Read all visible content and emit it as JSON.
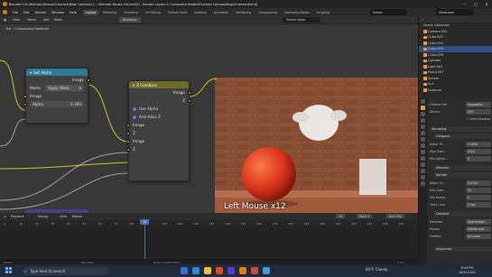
{
  "window": {
    "title": "Blender* [D:\\Blender\\Manual\\Courses\\New Courses\\11 - Ultimate Nodes Course\\00 - Render Layers & Composite Nodes\\Finished Compositing\\Finished.blend]",
    "minimize": "—",
    "maximize": "□",
    "close": "✕"
  },
  "menu": {
    "items": [
      "File",
      "Edit",
      "Render",
      "Window",
      "Help"
    ],
    "tabs": [
      "Layout",
      "Modeling",
      "Sculpting",
      "UV Editing",
      "Texture Paint",
      "Shading",
      "Animation",
      "Rendering",
      "Compositing",
      "Geometry Nodes",
      "Scripting"
    ],
    "active_tab": "Layout",
    "scene": "Scene",
    "view_layer": "ViewLayer"
  },
  "node_editor": {
    "header_items": [
      "View",
      "Select",
      "Add",
      "Node"
    ],
    "backdrop_btn": "Backdrop",
    "viewer_node": "Viewer Node",
    "breadcrumb_scene": "Test",
    "breadcrumb_tree": "Compositing Nodetree"
  },
  "set_alpha_node": {
    "title": "Set Alpha",
    "output": "Image",
    "mode_label": "Mode:",
    "mode_value": "Apply Mask",
    "input_image": "Image",
    "alpha_label": "Alpha",
    "alpha_value": "0.300"
  },
  "z_combine_node": {
    "title": "Z Combine",
    "out_image": "Image",
    "out_z": "Z",
    "use_alpha": "Use Alpha",
    "anti_alias": "Anti-Alias Z",
    "inputs": [
      "Image",
      "Z",
      "Image",
      "Z"
    ]
  },
  "viewport_overlay": "Left Mouse x12",
  "timeline": {
    "header_items": [
      "Playback",
      "Keying",
      "View",
      "Marker"
    ],
    "ruler": [
      "0",
      "10",
      "20",
      "30",
      "40",
      "50",
      "60",
      "70",
      "80",
      "90",
      "100",
      "110",
      "120",
      "130",
      "140",
      "150",
      "160",
      "170",
      "180",
      "190",
      "200",
      "210",
      "220",
      "230",
      "240",
      "250"
    ],
    "current_frame": "70",
    "start_label": "Start",
    "start_value": "1",
    "end_label": "End",
    "end_value": "250",
    "status_left": "Select",
    "status_mid": "Pan View",
    "status_right": "Node Context Menu",
    "version": "3.3.0"
  },
  "outliner": {
    "header": "Scene Collection",
    "items": [
      "Camera.001",
      "Cube.002",
      "Cube.004",
      "Cube.005",
      "Cube.006",
      "Cylinder",
      "Light.001",
      "Plane.007",
      "Sphere",
      "Sun",
      "Suzanne"
    ],
    "selected_index": 3
  },
  "properties": {
    "feature_set_label": "Feature Set",
    "feature_set_value": "Supported",
    "device_label": "Device",
    "device_value": "CPU",
    "open_shading": "Open Shading",
    "sampling": "Sampling",
    "viewport": "Viewport",
    "noise_threshold_label": "Noise Th...",
    "noise_threshold_value": "0.1000",
    "max_samples_label": "Max Sam...",
    "max_samples_value": "1024",
    "min_samples_label": "Min Sampl...",
    "min_samples_value": "0",
    "denoise": "Denoise",
    "render": "Render",
    "r_noise_label": "Noise Th...",
    "r_noise_value": "0.0100",
    "r_max_label": "Max Sam...",
    "r_max_value": "32",
    "r_min_label": "Min Sampl...",
    "r_min_value": "0",
    "time_limit_label": "Time Limit",
    "time_limit_value": "0 sec",
    "denoise2": "Denoise",
    "denoiser_label": "Denoiser",
    "denoiser_value": "OpenImage...",
    "passes_label": "Passes",
    "passes_value": "Albedo and...",
    "prefilter_label": "Prefilter",
    "prefilter_value": "Accurate",
    "advanced": "Advanced"
  },
  "taskbar": {
    "search_placeholder": "Type here to search",
    "weather": "64°F Cloudy",
    "time": "8:44 PM",
    "date": "10/31/2022"
  }
}
